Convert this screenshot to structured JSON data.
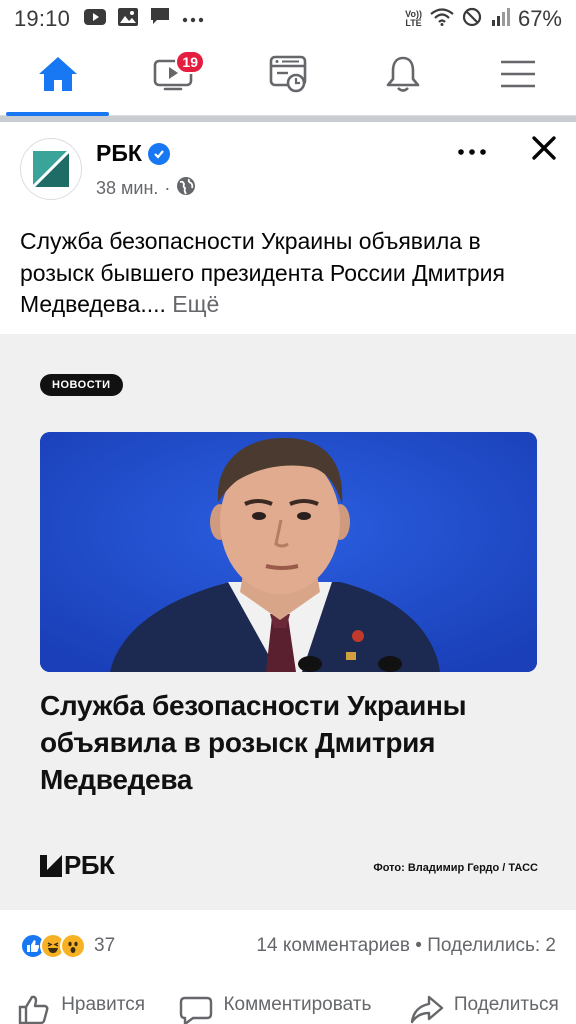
{
  "status": {
    "time": "19:10",
    "battery": "67%",
    "volte_top": "Vo))",
    "volte_bottom": "LTE"
  },
  "nav": {
    "items": [
      "home-icon",
      "watch-icon",
      "feeds-icon",
      "notifications-icon",
      "menu-icon"
    ],
    "watch_badge": "19"
  },
  "post": {
    "page_name": "РБК",
    "time_ago": "38 мин.",
    "separator": "·",
    "text": "Служба безопасности Украины объявила в розыск бывшего президента России Дмитрия Медведева....",
    "see_more": "Ещё"
  },
  "card": {
    "tag": "НОВОСТИ",
    "headline": "Служба безопасности Украины объявила в розыск Дмитрия Медведева",
    "logo": "РБК",
    "photo_credit": "Фото: Владимир Гердо / ТАСС"
  },
  "reactions": {
    "count": "37",
    "comments": "14 комментариев",
    "dot": "•",
    "shares": "Поделились: 2"
  },
  "actions": {
    "like": "Нравится",
    "comment": "Комментировать",
    "share": "Поделиться"
  },
  "colors": {
    "accent": "#1877f2",
    "badge": "#e41e3f",
    "secondary_text": "#65676b"
  }
}
